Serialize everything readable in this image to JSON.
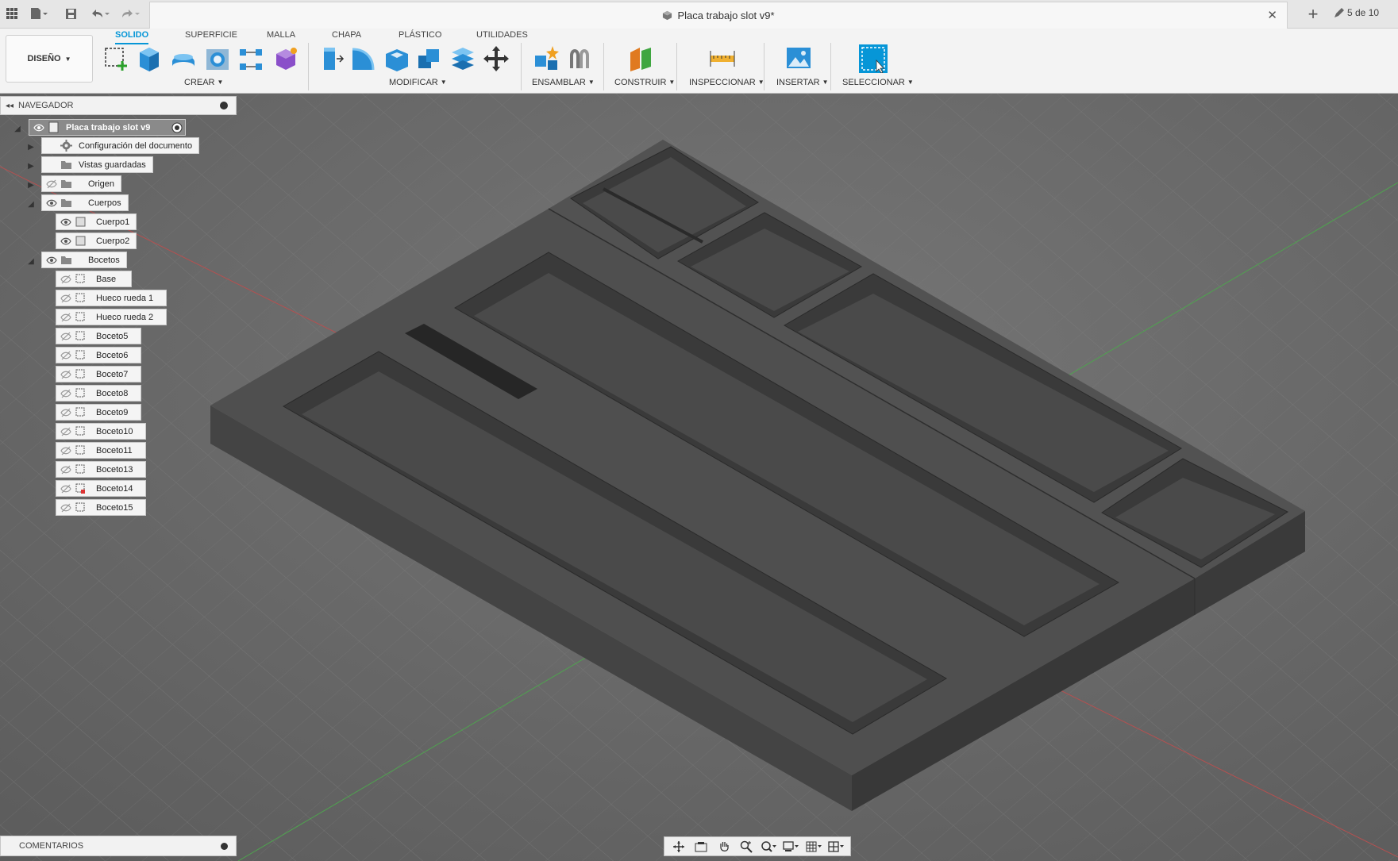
{
  "window": {
    "document_title": "Placa trabajo slot v9*",
    "page_count": "5 de 10"
  },
  "ribbon": {
    "workspace": "DISEÑO",
    "tabs": [
      "SOLIDO",
      "SUPERFICIE",
      "MALLA",
      "CHAPA",
      "PLÁSTICO",
      "UTILIDADES"
    ],
    "active_tab": "SOLIDO",
    "groups": [
      "CREAR",
      "MODIFICAR",
      "ENSAMBLAR",
      "CONSTRUIR",
      "INSPECCIONAR",
      "INSERTAR",
      "SELECCIONAR"
    ]
  },
  "browser": {
    "title": "NAVEGADOR",
    "root": "Placa trabajo slot v9",
    "nodes": [
      {
        "label": "Configuración del documento"
      },
      {
        "label": "Vistas guardadas"
      },
      {
        "label": "Origen"
      },
      {
        "label": "Cuerpos"
      },
      {
        "label": "Cuerpo1"
      },
      {
        "label": "Cuerpo2"
      },
      {
        "label": "Bocetos"
      },
      {
        "label": "Base"
      },
      {
        "label": "Hueco rueda 1"
      },
      {
        "label": "Hueco rueda 2"
      },
      {
        "label": "Boceto5"
      },
      {
        "label": "Boceto6"
      },
      {
        "label": "Boceto7"
      },
      {
        "label": "Boceto8"
      },
      {
        "label": "Boceto9"
      },
      {
        "label": "Boceto10"
      },
      {
        "label": "Boceto11"
      },
      {
        "label": "Boceto13"
      },
      {
        "label": "Boceto14"
      },
      {
        "label": "Boceto15"
      }
    ]
  },
  "comments": {
    "title": "COMENTARIOS"
  },
  "colors": {
    "accent": "#0696d7",
    "viewport_background": "#6b6b6b",
    "model_top": "#4f4f4f",
    "model_side": "#3c3c3c"
  }
}
